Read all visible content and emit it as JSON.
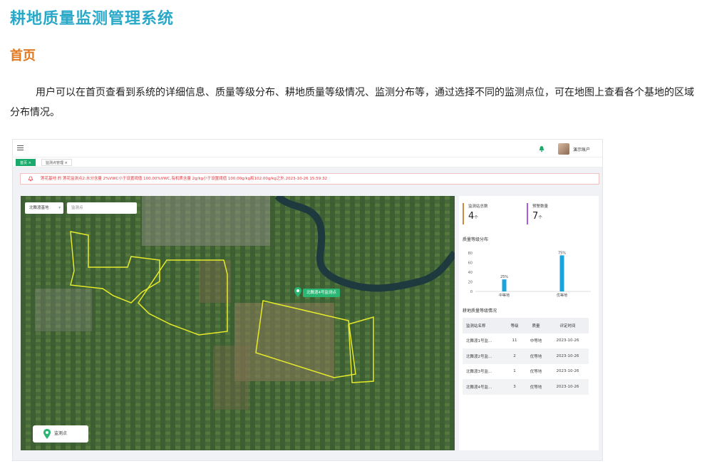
{
  "doc": {
    "title": "耕地质量监测管理系统",
    "section": "首页",
    "paragraph": "用户可以在首页查看到系统的详细信息、质量等级分布、耕地质量等级情况、监测分布等，通过选择不同的监测点位，可在地图上查看各个基地的区域分布情况。"
  },
  "app": {
    "account": "演示账户",
    "tabs": [
      {
        "label": "首页 ×",
        "active": true
      },
      {
        "label": "监测点管理 ×",
        "active": false
      }
    ],
    "alert_text": "莲花基地 的 莲花监测点2:水分含量 2%VWC小于设置阈值 100.00%VWC,有机质含量 2g/kg小于设置阈值 100.00g/kg和102.00g/kg之外,2023-10-26 15:59:32",
    "map": {
      "base_select": "北舞渡基地",
      "point_select_placeholder": "监测点",
      "marker_label": "北舞渡4号监测点",
      "legend_label": "监测点"
    },
    "stats": [
      {
        "label": "监测站总数",
        "value": "4",
        "unit": "个",
        "color": "#c98a3a"
      },
      {
        "label": "预警数量",
        "value": "7",
        "unit": "个",
        "color": "#a55de0"
      }
    ],
    "grade_chart_title": "质量等级分布",
    "quality_table_title": "耕地质量等级情况",
    "table": {
      "headers": [
        "监测站名称",
        "等级",
        "质量",
        "评定时间"
      ],
      "rows": [
        [
          "北舞渡1号监...",
          "11",
          "中等地",
          "2023-10-26"
        ],
        [
          "北舞渡2号监...",
          "2",
          "优等地",
          "2023-10-26"
        ],
        [
          "北舞渡3号监...",
          "1",
          "优等地",
          "2023-10-26"
        ],
        [
          "北舞渡4号监...",
          "3",
          "优等地",
          "2023-10-26"
        ]
      ]
    }
  },
  "chart_data": {
    "type": "bar",
    "title": "质量等级分布",
    "categories": [
      "中等地",
      "优等地"
    ],
    "values": [
      25,
      75
    ],
    "data_labels": [
      "25%",
      "75%"
    ],
    "yticks": [
      "80",
      "60",
      "40",
      "20",
      "0"
    ],
    "ylim": [
      0,
      80
    ],
    "bar_color": "#1aa3dc"
  }
}
